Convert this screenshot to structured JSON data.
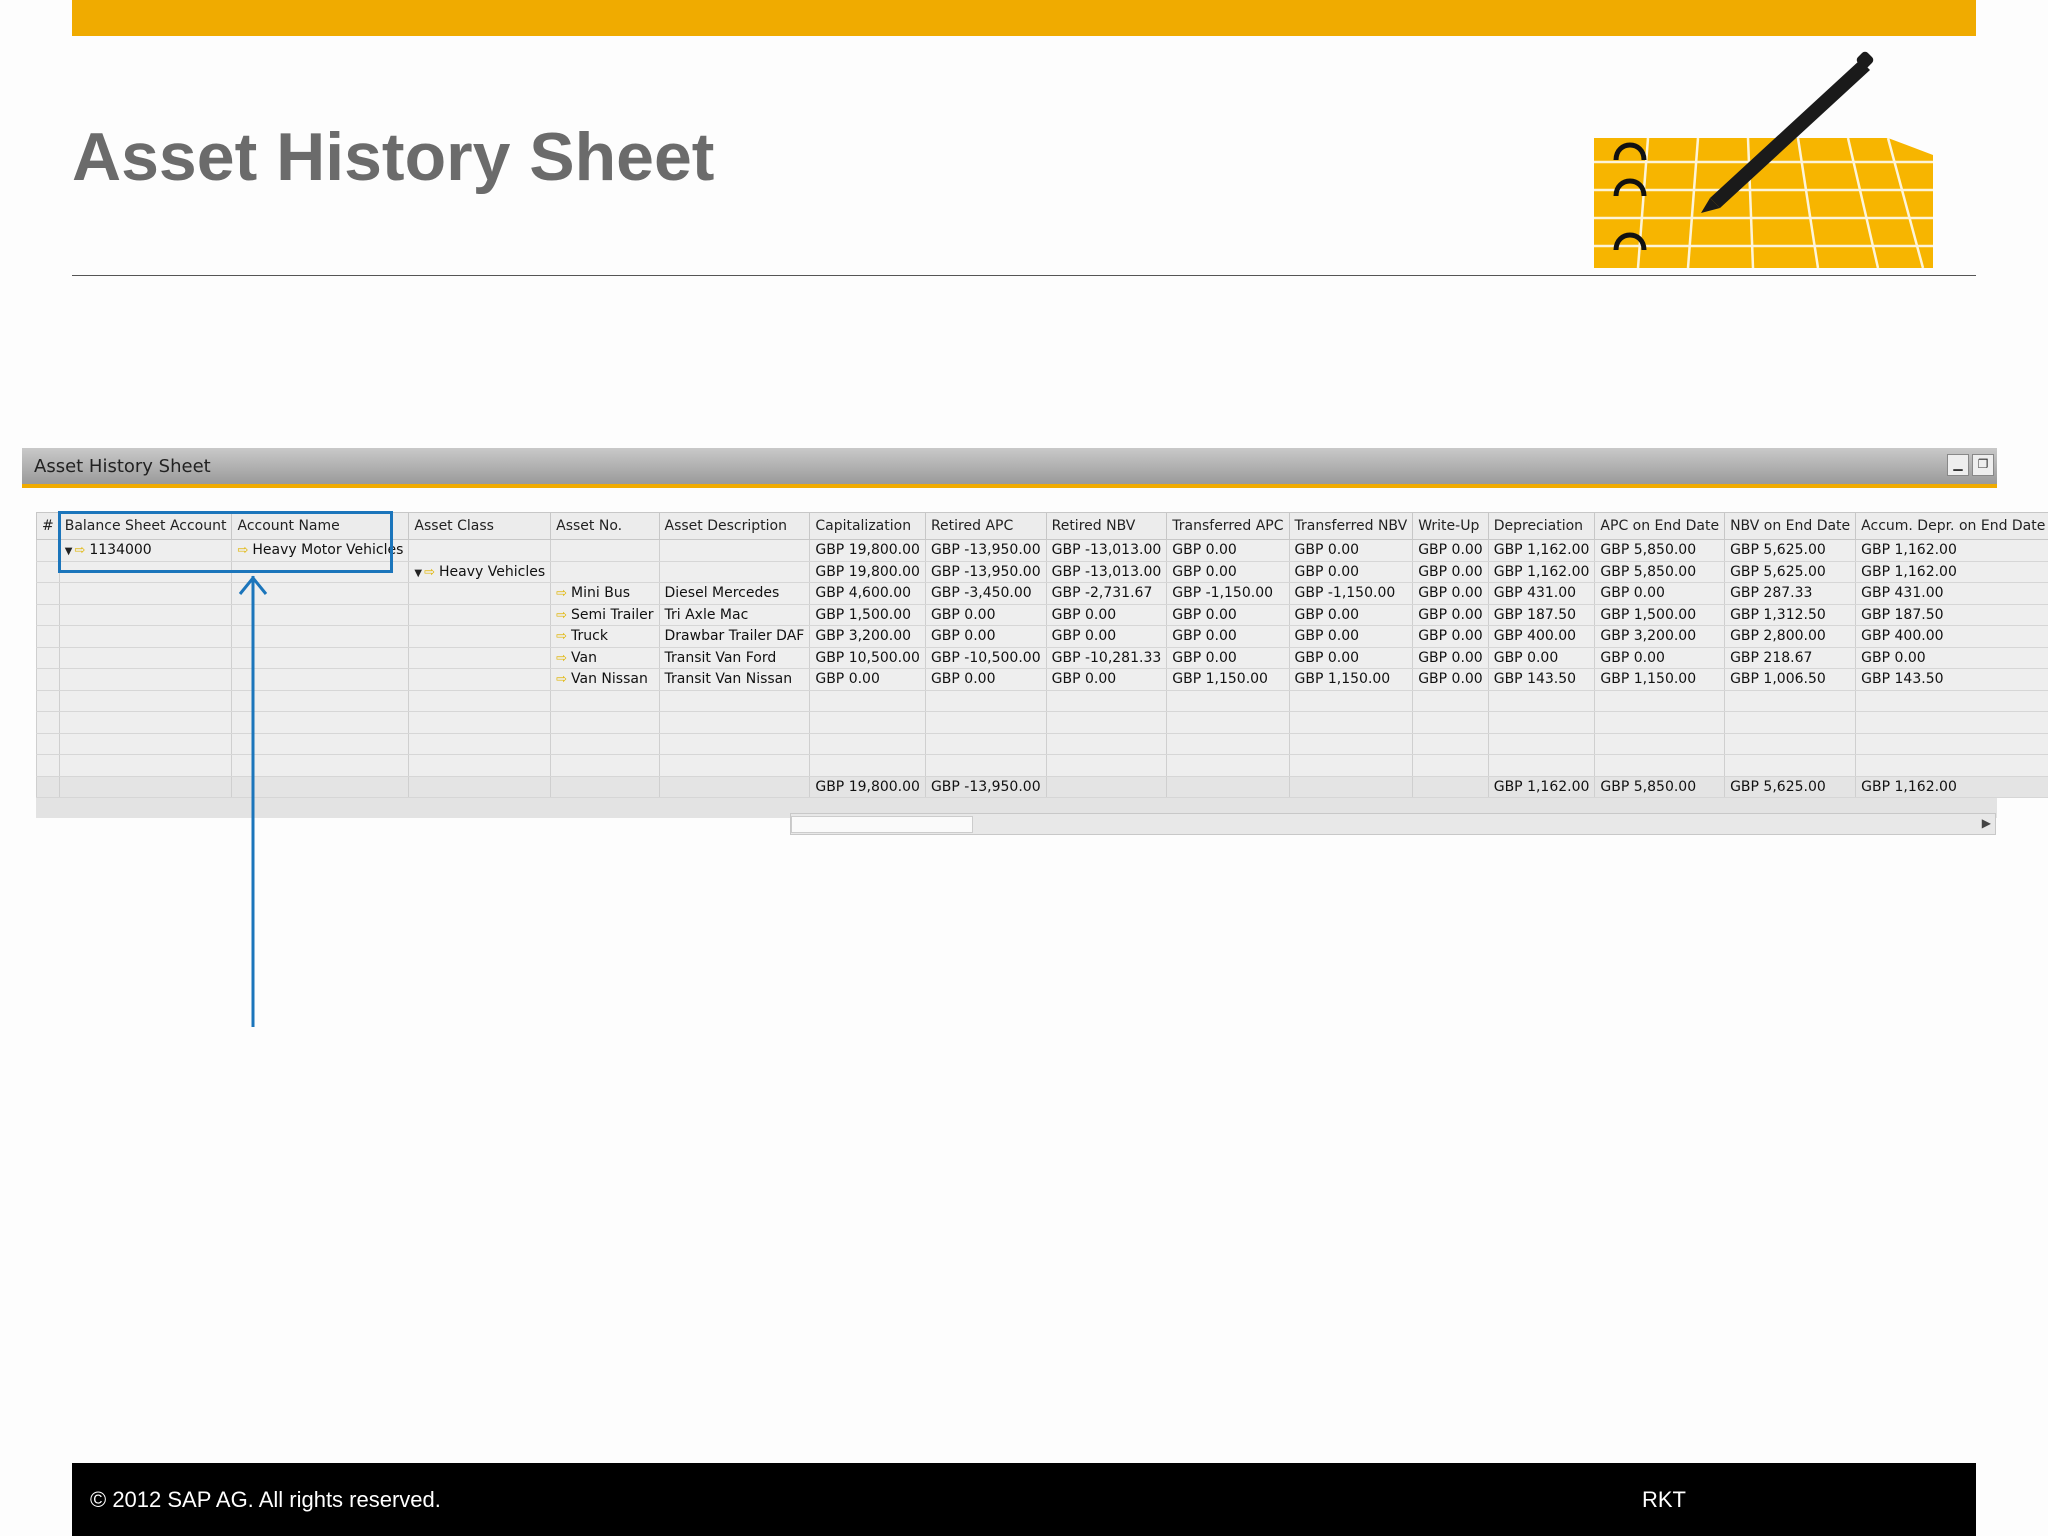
{
  "slide": {
    "title": "Asset History Sheet",
    "footer_copyright": "©  2012 SAP AG. All rights reserved.",
    "footer_code": "RKT",
    "logo_icon": "notebook-pen-icon",
    "accent_color": "#f0ab00",
    "highlight_color": "#1b75bb"
  },
  "window": {
    "title": "Asset History Sheet",
    "minimize_icon": "minimize-icon",
    "restore_icon": "restore-icon"
  },
  "table": {
    "columns": [
      "#",
      "Balance Sheet Account",
      "Account Name",
      "Asset Class",
      "Asset No.",
      "Asset Description",
      "Capitalization",
      "Retired APC",
      "Retired NBV",
      "Transferred APC",
      "Transferred NBV",
      "Write-Up",
      "Depreciation",
      "APC on End Date",
      "NBV on End Date",
      "Accum. Depr. on End Date"
    ],
    "rows": [
      [
        "",
        "1134000",
        "Heavy Motor Vehicles",
        "",
        "",
        "",
        "GBP 19,800.00",
        "GBP -13,950.00",
        "GBP -13,013.00",
        "GBP 0.00",
        "GBP 0.00",
        "GBP 0.00",
        "GBP 1,162.00",
        "GBP 5,850.00",
        "GBP 5,625.00",
        "GBP 1,162.00"
      ],
      [
        "",
        "",
        "",
        "Heavy Vehicles",
        "",
        "",
        "GBP 19,800.00",
        "GBP -13,950.00",
        "GBP -13,013.00",
        "GBP 0.00",
        "GBP 0.00",
        "GBP 0.00",
        "GBP 1,162.00",
        "GBP 5,850.00",
        "GBP 5,625.00",
        "GBP 1,162.00"
      ],
      [
        "",
        "",
        "",
        "",
        "Mini Bus",
        "Diesel Mercedes",
        "GBP 4,600.00",
        "GBP -3,450.00",
        "GBP -2,731.67",
        "GBP -1,150.00",
        "GBP -1,150.00",
        "GBP 0.00",
        "GBP 431.00",
        "GBP 0.00",
        "GBP 287.33",
        "GBP 431.00"
      ],
      [
        "",
        "",
        "",
        "",
        "Semi Trailer",
        "Tri Axle Mac",
        "GBP 1,500.00",
        "GBP 0.00",
        "GBP 0.00",
        "GBP 0.00",
        "GBP 0.00",
        "GBP 0.00",
        "GBP 187.50",
        "GBP 1,500.00",
        "GBP 1,312.50",
        "GBP 187.50"
      ],
      [
        "",
        "",
        "",
        "",
        "Truck",
        "Drawbar Trailer DAF",
        "GBP 3,200.00",
        "GBP 0.00",
        "GBP 0.00",
        "GBP 0.00",
        "GBP 0.00",
        "GBP 0.00",
        "GBP 400.00",
        "GBP 3,200.00",
        "GBP 2,800.00",
        "GBP 400.00"
      ],
      [
        "",
        "",
        "",
        "",
        "Van",
        "Transit Van Ford",
        "GBP 10,500.00",
        "GBP -10,500.00",
        "GBP -10,281.33",
        "GBP 0.00",
        "GBP 0.00",
        "GBP 0.00",
        "GBP 0.00",
        "GBP 0.00",
        "GBP 218.67",
        "GBP 0.00"
      ],
      [
        "",
        "",
        "",
        "",
        "Van Nissan",
        "Transit Van Nissan",
        "GBP 0.00",
        "GBP 0.00",
        "GBP 0.00",
        "GBP 1,150.00",
        "GBP 1,150.00",
        "GBP 0.00",
        "GBP 143.50",
        "GBP 1,150.00",
        "GBP 1,006.50",
        "GBP 143.50"
      ]
    ],
    "totals": [
      "",
      "",
      "",
      "",
      "",
      "",
      "GBP 19,800.00",
      "GBP -13,950.00",
      "",
      "",
      "",
      "",
      "GBP 1,162.00",
      "GBP 5,850.00",
      "GBP 5,625.00",
      "GBP 1,162.00"
    ]
  }
}
